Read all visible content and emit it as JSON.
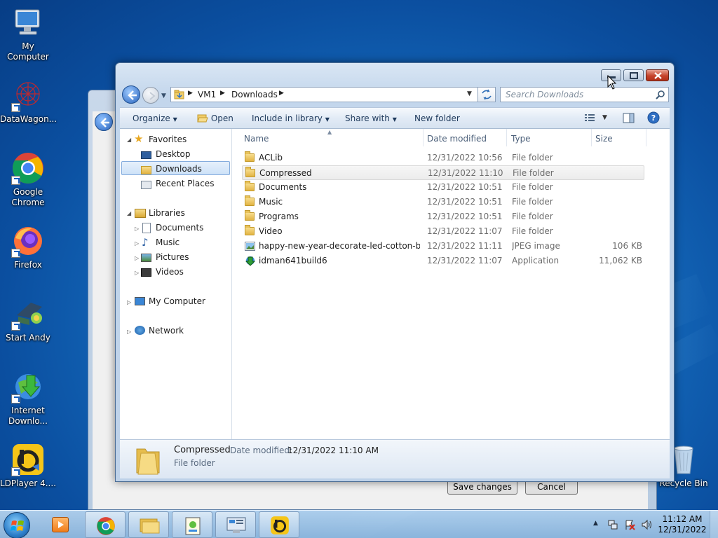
{
  "desktop": {
    "icons": [
      {
        "label": "My Computer",
        "icon": "computer-icon"
      },
      {
        "label": "DataWagon...",
        "icon": "datawagon-icon"
      },
      {
        "label": "Google Chrome",
        "icon": "chrome-icon"
      },
      {
        "label": "Firefox",
        "icon": "firefox-icon"
      },
      {
        "label": "Start Andy",
        "icon": "andy-icon"
      },
      {
        "label": "Internet Downlo...",
        "icon": "idm-icon"
      },
      {
        "label": "LDPlayer 4....",
        "icon": "ldplayer-icon"
      },
      {
        "label": "Recycle Bin",
        "icon": "recycle-bin-icon"
      }
    ]
  },
  "background_dialog": {
    "save_label": "Save changes",
    "cancel_label": "Cancel"
  },
  "explorer": {
    "breadcrumb": [
      "VM1",
      "Downloads"
    ],
    "search_placeholder": "Search Downloads",
    "commands": {
      "organize": "Organize",
      "open": "Open",
      "include": "Include in library",
      "share": "Share with",
      "new_folder": "New folder"
    },
    "tree": {
      "favorites": "Favorites",
      "desktop": "Desktop",
      "downloads": "Downloads",
      "recent": "Recent Places",
      "libraries": "Libraries",
      "documents": "Documents",
      "music": "Music",
      "pictures": "Pictures",
      "videos": "Videos",
      "computer": "My Computer",
      "network": "Network"
    },
    "columns": {
      "name": "Name",
      "date": "Date modified",
      "type": "Type",
      "size": "Size"
    },
    "files": [
      {
        "name": "ACLib",
        "date": "12/31/2022 10:56 ...",
        "type": "File folder",
        "size": ""
      },
      {
        "name": "Compressed",
        "date": "12/31/2022 11:10 ...",
        "type": "File folder",
        "size": ""
      },
      {
        "name": "Documents",
        "date": "12/31/2022 10:51 ...",
        "type": "File folder",
        "size": ""
      },
      {
        "name": "Music",
        "date": "12/31/2022 10:51 ...",
        "type": "File folder",
        "size": ""
      },
      {
        "name": "Programs",
        "date": "12/31/2022 10:51 ...",
        "type": "File folder",
        "size": ""
      },
      {
        "name": "Video",
        "date": "12/31/2022 11:07 ...",
        "type": "File folder",
        "size": ""
      },
      {
        "name": "happy-new-year-decorate-led-cotton-ba...",
        "date": "12/31/2022 11:11 ...",
        "type": "JPEG image",
        "size": "106 KB"
      },
      {
        "name": "idman641build6",
        "date": "12/31/2022 11:07 ...",
        "type": "Application",
        "size": "11,062 KB"
      }
    ],
    "details": {
      "name": "Compressed",
      "date_label": "Date modified:",
      "date_value": "12/31/2022 11:10 AM",
      "type": "File folder"
    }
  },
  "taskbar": {
    "time": "11:12 AM",
    "date": "12/31/2022"
  },
  "colors": {
    "desktop_blue": "#1670c2",
    "selection": "#cde2f8",
    "close_red": "#c5432c"
  }
}
